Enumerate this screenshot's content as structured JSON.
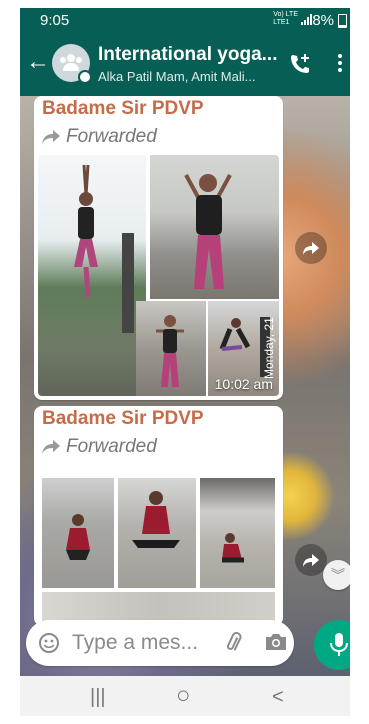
{
  "status_bar": {
    "time": "9:05",
    "network": "Vo) LTE\nLTE1",
    "battery": "8%"
  },
  "header": {
    "title": "International yoga...",
    "subtitle": "Alka Patil Mam, Amit Mali..."
  },
  "messages": [
    {
      "sender": "Badame Sir PDVP",
      "forwarded": "Forwarded",
      "time": "10:02 am",
      "photo_date": "Monday, 21"
    },
    {
      "sender": "Badame Sir PDVP",
      "forwarded": "Forwarded"
    }
  ],
  "composer": {
    "placeholder": "Type a mes..."
  },
  "nav": {
    "recents": "|||",
    "home": "○",
    "back": "<"
  },
  "colors": {
    "header": "#075e54",
    "accent": "#00a884",
    "sender": "#c56d4a"
  }
}
